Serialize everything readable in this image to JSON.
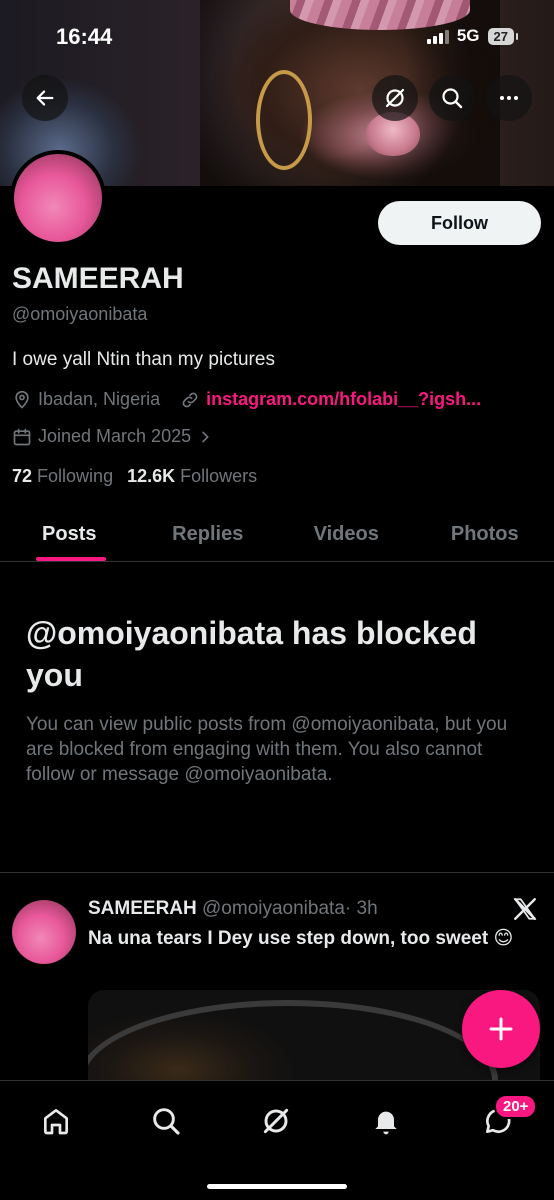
{
  "status_bar": {
    "time": "16:44",
    "network": "5G",
    "battery": "27"
  },
  "header": {
    "back_icon": "arrow-left-icon",
    "grok_icon": "grok-icon",
    "search_icon": "search-icon",
    "more_icon": "more-horizontal-icon"
  },
  "profile": {
    "name": "SAMEERAH",
    "handle": "@omoiyaonibata",
    "bio": "I owe yall Ntin than my pictures",
    "location": "Ibadan, Nigeria",
    "website": "instagram.com/hfolabi__?igsh...",
    "joined": "Joined March 2025",
    "following_count": "72",
    "following_label": "Following",
    "followers_count": "12.6K",
    "followers_label": "Followers",
    "follow_label": "Follow"
  },
  "tabs": [
    {
      "label": "Posts",
      "active": true
    },
    {
      "label": "Replies",
      "active": false
    },
    {
      "label": "Videos",
      "active": false
    },
    {
      "label": "Photos",
      "active": false
    }
  ],
  "blocked": {
    "title": "@omoiyaonibata has blocked you",
    "body": "You can view public posts from @omoiyaonibata, but you are blocked from engaging with them. You also cannot follow or message @omoiyaonibata."
  },
  "post": {
    "author": "SAMEERAH",
    "handle": "@omoiyaonibata",
    "time": "· 3h",
    "text": "Na una tears I Dey use step down, too sweet 😊"
  },
  "bottom_nav": {
    "items": [
      "home-icon",
      "search-icon",
      "grok-icon",
      "notifications-icon",
      "messages-icon"
    ],
    "messages_badge": "20+"
  },
  "colors": {
    "accent": "#f91880",
    "muted": "#71767b",
    "text": "#e7e9ea",
    "background": "#000000"
  }
}
